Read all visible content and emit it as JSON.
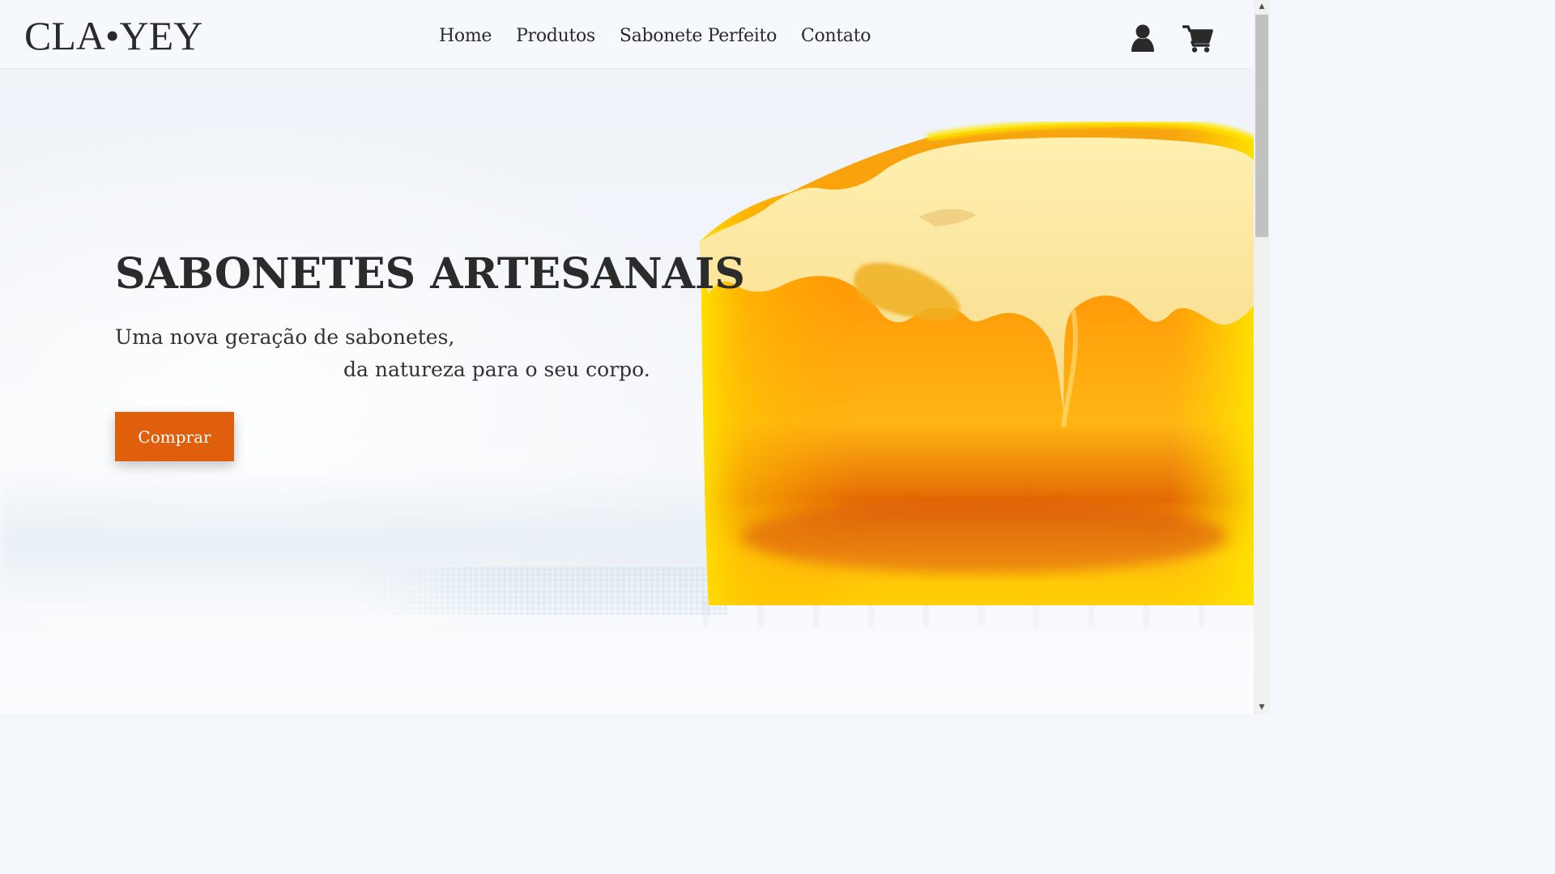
{
  "header": {
    "logo": "CLA•YEY",
    "nav": [
      {
        "label": "Home"
      },
      {
        "label": "Produtos"
      },
      {
        "label": "Sabonete Perfeito"
      },
      {
        "label": "Contato"
      }
    ],
    "icons": [
      "user-icon",
      "shopping-cart-icon"
    ]
  },
  "hero": {
    "title": "SABONETES ARTESANAIS",
    "subtitle_line1": "Uma nova geração de sabonetes,",
    "subtitle_line2": "da natureza para o seu corpo.",
    "cta_label": "Comprar",
    "image": "orange-yellow-soap-bar"
  },
  "colors": {
    "accent": "#e05f0c",
    "text": "#2b2b2b",
    "soap_orange": "#f5a010",
    "soap_yellow": "#ffd200"
  },
  "scrollbar": {
    "up_arrow": "▲",
    "down_arrow": "▼"
  }
}
